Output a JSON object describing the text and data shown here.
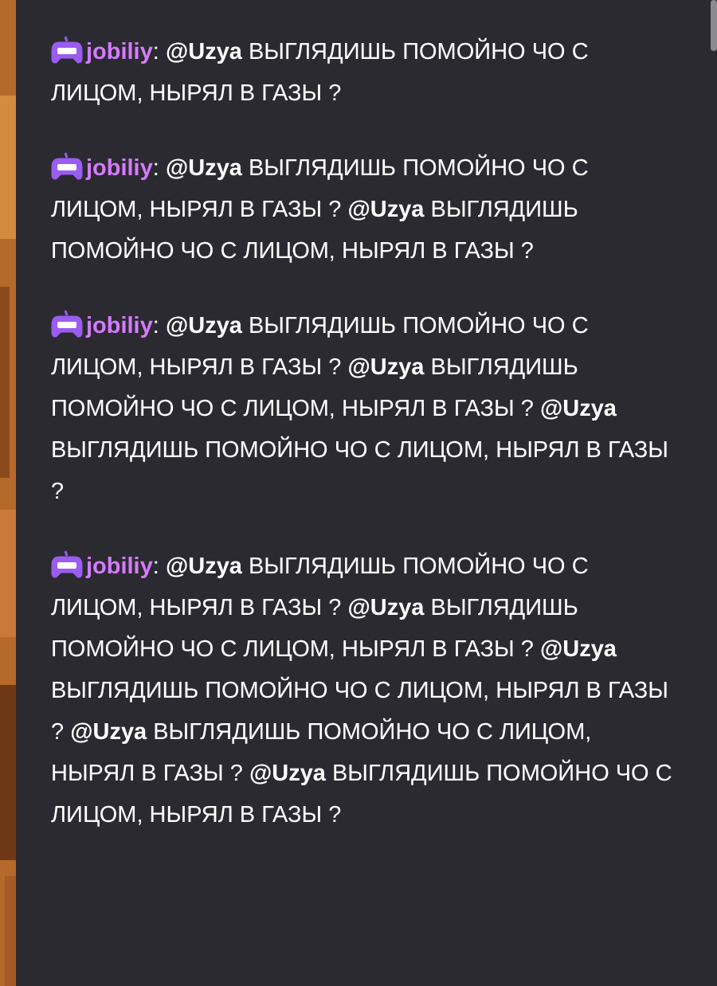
{
  "chat": {
    "messages": [
      {
        "username": "jobiliy",
        "text": ": **@Uzya** ВЫГЛЯДИШЬ ПОМОЙНО ЧО С ЛИЦОМ, НЫРЯЛ В ГАЗЫ ?"
      },
      {
        "username": "jobiliy",
        "text": ": **@Uzya** ВЫГЛЯДИШЬ ПОМОЙНО ЧО С ЛИЦОМ, НЫРЯЛ В ГАЗЫ ? **@Uzya** ВЫГЛЯДИШЬ ПОМОЙНО ЧО С ЛИЦОМ, НЫРЯЛ В ГАЗЫ ?"
      },
      {
        "username": "jobiliy",
        "text": ": **@Uzya** ВЫГЛЯДИШЬ ПОМОЙНО ЧО С ЛИЦОМ, НЫРЯЛ В ГАЗЫ ? **@Uzya** ВЫГЛЯДИШЬ ПОМОЙНО ЧО С ЛИЦОМ, НЫРЯЛ В ГАЗЫ ? **@Uzya** ВЫГЛЯДИШЬ ПОМОЙНО ЧО С ЛИЦОМ, НЫРЯЛ В ГАЗЫ ?"
      },
      {
        "username": "jobiliy",
        "text": ": **@Uzya** ВЫГЛЯДИШЬ ПОМОЙНО ЧО С ЛИЦОМ, НЫРЯЛ В ГАЗЫ ? **@Uzya** ВЫГЛЯДИШЬ ПОМОЙНО ЧО С ЛИЦОМ, НЫРЯЛ В ГАЗЫ ? **@Uzya** ВЫГЛЯДИШЬ ПОМОЙНО ЧО С ЛИЦОМ, НЫРЯЛ В ГАЗЫ ? **@Uzya** ВЫГЛЯДИШЬ ПОМОЙНО ЧО С ЛИЦОМ, НЫРЯЛ В ГАЗЫ ? **@Uzya** ВЫГЛЯДИШЬ ПОМОЙНО ЧО С ЛИЦОМ, НЫРЯЛ В ГАЗЫ ?"
      }
    ]
  }
}
